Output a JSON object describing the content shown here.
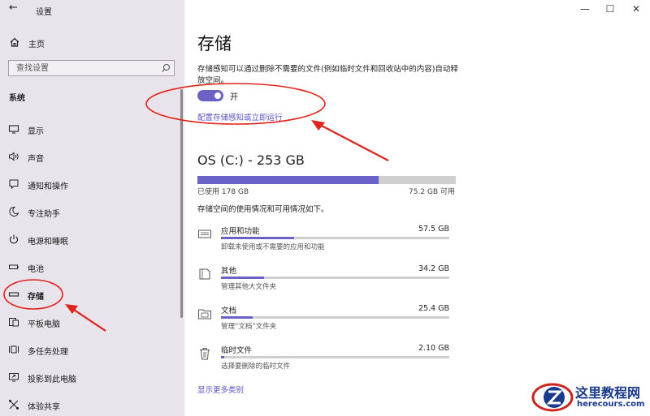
{
  "window": {
    "title": "设置",
    "controls": {
      "minimize": "—",
      "maximize": "☐",
      "close": "✕"
    }
  },
  "sidebar": {
    "back_icon": "back-arrow-icon",
    "home_label": "主页",
    "search_placeholder": "查找设置",
    "section_title": "系统",
    "items": [
      {
        "label": "显示",
        "icon": "display-icon"
      },
      {
        "label": "声音",
        "icon": "sound-icon"
      },
      {
        "label": "通知和操作",
        "icon": "notification-icon"
      },
      {
        "label": "专注助手",
        "icon": "moon-icon"
      },
      {
        "label": "电源和睡眠",
        "icon": "power-icon"
      },
      {
        "label": "电池",
        "icon": "battery-icon"
      },
      {
        "label": "存储",
        "icon": "storage-icon",
        "selected": true
      },
      {
        "label": "平板电脑",
        "icon": "tablet-icon"
      },
      {
        "label": "多任务处理",
        "icon": "multitask-icon"
      },
      {
        "label": "投影到此电脑",
        "icon": "project-icon"
      },
      {
        "label": "体验共享",
        "icon": "share-icon"
      }
    ]
  },
  "main": {
    "title": "存储",
    "description": "存储感知可以通过删除不需要的文件(例如临时文件和回收站中的内容)自动释放空间。",
    "toggle_state": "开",
    "toggle_on": true,
    "config_link": "配置存储感知或立即运行",
    "drive": {
      "title": "OS (C:) - 253 GB",
      "used_text": "已使用 178 GB",
      "free_text": "75.2 GB 可用",
      "used_fraction": 0.7
    },
    "usage_description": "存储空间的使用情况和可用情况如下。",
    "categories": [
      {
        "name": "应用和功能",
        "size": "57.5 GB",
        "sub": "卸载未使用或不需要的应用和功能",
        "fraction": 0.32,
        "icon": "apps-icon"
      },
      {
        "name": "其他",
        "size": "34.2 GB",
        "sub": "管理其他大文件夹",
        "fraction": 0.19,
        "icon": "other-files-icon"
      },
      {
        "name": "文档",
        "size": "25.4 GB",
        "sub": "管理“文档”文件夹",
        "fraction": 0.14,
        "icon": "folder-icon"
      },
      {
        "name": "临时文件",
        "size": "2.10 GB",
        "sub": "选择要删除的临时文件",
        "fraction": 0.015,
        "icon": "trash-icon"
      }
    ],
    "more_link": "显示更多类别"
  },
  "watermark": {
    "title": "这里教程网",
    "url": "herecours.com"
  },
  "colors": {
    "accent": "#6b62c6",
    "link": "#5b52c3",
    "sidebar_bg": "#e9e3ec",
    "annotation_red": "#e0231c"
  }
}
